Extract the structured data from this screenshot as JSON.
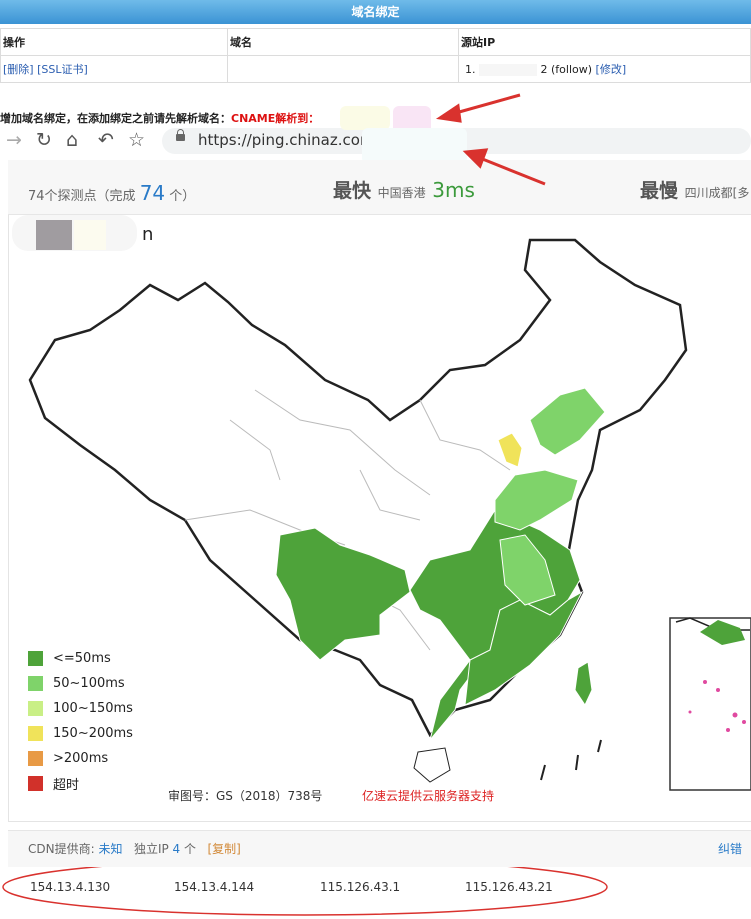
{
  "header": {
    "title": "域名绑定"
  },
  "binding_table": {
    "columns": [
      "操作",
      "域名",
      "源站IP"
    ],
    "row": {
      "delete": "[删除]",
      "ssl": "[SSL证书]",
      "domain": "",
      "ip_prefix": "1.",
      "ip_suffix": "2 (follow)",
      "modify": "[修改]"
    }
  },
  "hint": {
    "text": "增加域名绑定，在添加绑定之前请先解析域名：",
    "cname": "CNAME解析到："
  },
  "browser": {
    "url": "https://ping.chinaz.com/"
  },
  "stats": {
    "total_prefix": "74个探测点（完成",
    "total_count": "74",
    "total_suffix": "个）",
    "fastest_label": "最快",
    "fastest_city": "中国香港",
    "fastest_ms": "3ms",
    "slowest_label": "最慢",
    "slowest_city": "四川成都[多"
  },
  "map": {
    "partial_label": "n"
  },
  "legend": [
    {
      "label": "<=50ms",
      "color": "#4ea33a"
    },
    {
      "label": "50~100ms",
      "color": "#7fd36a"
    },
    {
      "label": "100~150ms",
      "color": "#c9ef86"
    },
    {
      "label": "150~200ms",
      "color": "#f0e35a"
    },
    {
      "label": ">200ms",
      "color": "#e89a45"
    },
    {
      "label": "超时",
      "color": "#d1312a"
    }
  ],
  "map_footer": {
    "approval": "审图号：GS（2018）738号",
    "sponsor": "亿速云提供云服务器支持"
  },
  "cdn": {
    "provider_label": "CDN提供商:",
    "provider_value": "未知",
    "ip_label": "独立IP",
    "ip_count": "4",
    "ip_unit": "个",
    "copy": "[复制]",
    "report": "纠错"
  },
  "ips": [
    "154.13.4.130",
    "154.13.4.144",
    "115.126.43.1",
    "115.126.43.21"
  ],
  "colors": {
    "titlebar": "#3b93d4",
    "arrow": "#d9322e",
    "fast": "#3c9a3c",
    "link": "#2a7bc8"
  }
}
